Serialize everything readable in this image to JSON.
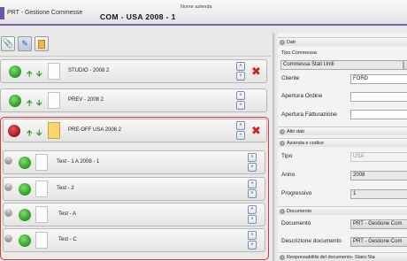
{
  "header": {
    "app_title": "PRT - Gestione Commesse",
    "azienda_label": "Nome azienda",
    "azienda_value": "COM - USA 2008 - 1"
  },
  "toolbar": {
    "buttons": [
      {
        "icon": "paperclip-icon"
      },
      {
        "icon": "edit-icon"
      },
      {
        "icon": "document-icon"
      }
    ]
  },
  "tree": {
    "rows": [
      {
        "label": "STUDIO - 2008 2",
        "status": "green"
      },
      {
        "label": "PREV - 2008 2",
        "status": "green"
      },
      {
        "label": "PRE-OFF USA 2008 2",
        "status": "red"
      },
      {
        "label": "Test - 1  A 2008 - 1",
        "status": "green"
      },
      {
        "label": "Test - 2",
        "status": "green"
      },
      {
        "label": "Test - A",
        "status": "green"
      },
      {
        "label": "Test - C",
        "status": "green"
      }
    ],
    "colors": {
      "group_border": "#d43a3a",
      "status_green": "#2a9a20",
      "status_red": "#a11515"
    }
  },
  "panel": {
    "dati": {
      "title": "Dati",
      "tipo_commessa_label": "Tipo Commessa",
      "tipo_commessa_value": "Commessa Stati Uniti",
      "cliente_label": "Cliente",
      "cliente_value": "FORD",
      "apertura_ordine_label": "Apertura Ordine",
      "apertura_ordine_value": "",
      "apertura_fatturazione_label": "Apertura Fatturazione",
      "apertura_fatturazione_value": ""
    },
    "altri_dati": {
      "title": "Altri dati"
    },
    "azienda": {
      "title": "Azienda e codice",
      "tipo_label": "Tipo",
      "tipo_value": "USA",
      "anno_label": "Anno",
      "anno_value": "2008",
      "progressivo_label": "Progressivo",
      "progressivo_value": "1"
    },
    "documento": {
      "title": "Documento",
      "documento_label": "Documento",
      "documento_value": "PRT - Gestione Com",
      "descrizione_label": "Descrizione documento",
      "descrizione_value": "PRT - Gestione Com"
    },
    "responsabilita": {
      "title": "Responsabilità del documento- Stato:Sta"
    }
  }
}
